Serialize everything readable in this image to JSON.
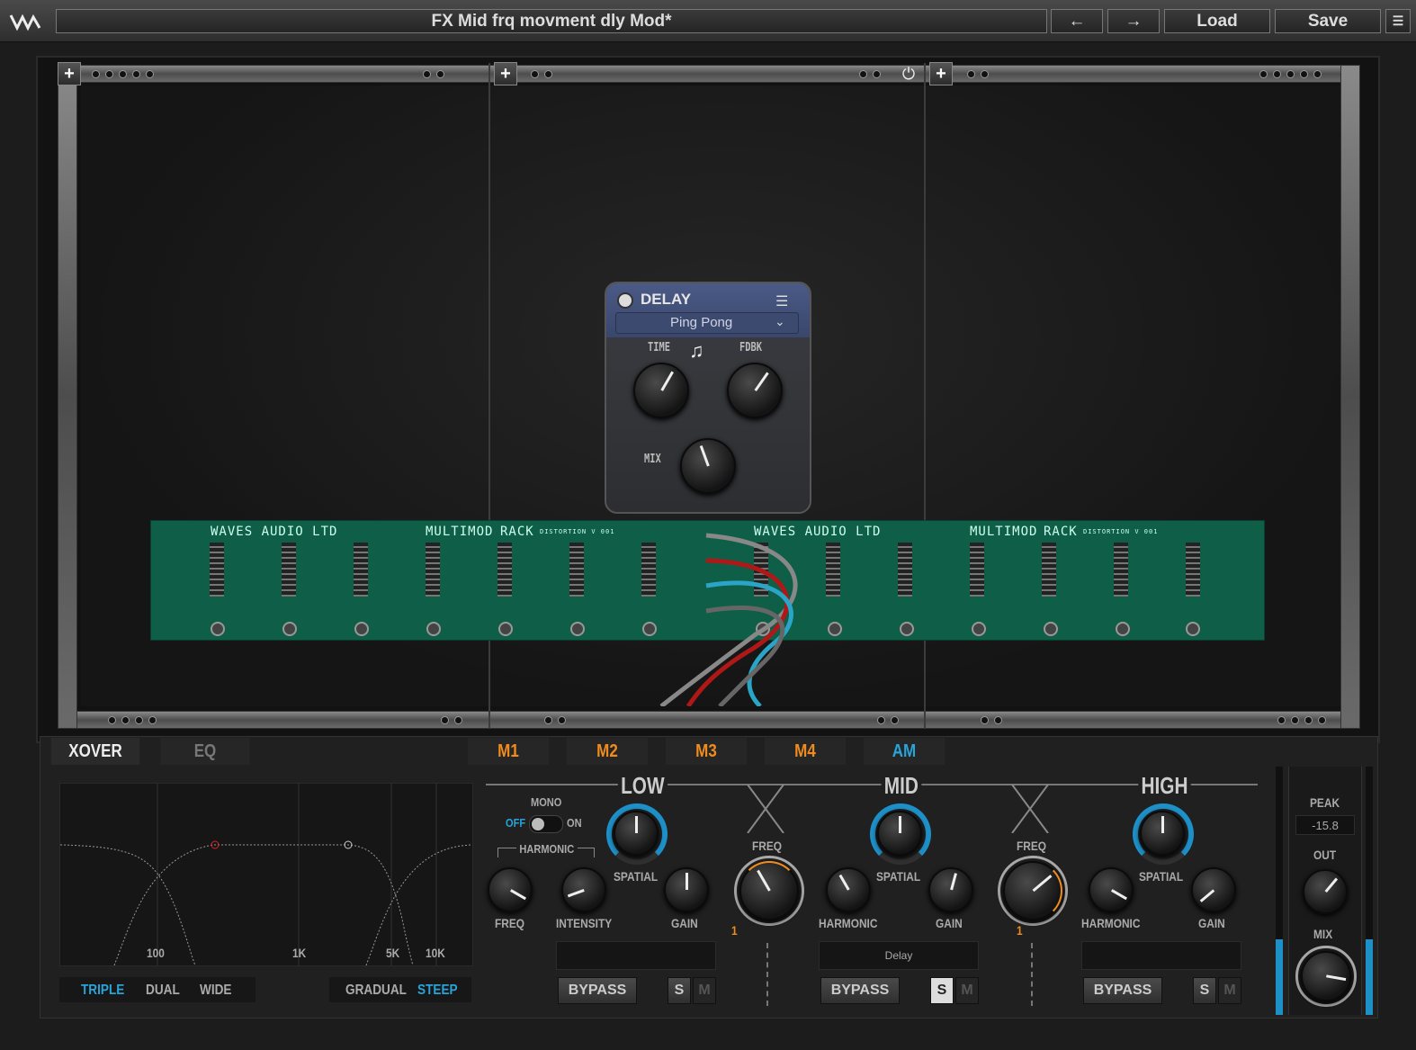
{
  "header": {
    "preset_title": "FX Mid frq movment dly Mod*",
    "load_label": "Load",
    "save_label": "Save",
    "undo_icon": "arrow-left-icon",
    "redo_icon": "arrow-right-icon",
    "logo_icon": "waves-logo-icon"
  },
  "rack": {
    "slot_add_label": "+",
    "power_icon": "power-icon"
  },
  "delay": {
    "title": "DELAY",
    "mode": "Ping Pong",
    "time_label": "TIME",
    "fdbk_label": "FDBK",
    "mix_label": "MIX",
    "note_icon": "music-note-icon",
    "menu_icon": "hamburger-menu-icon"
  },
  "pcb": {
    "maker": "WAVES AUDIO LTD",
    "maker2": "WAVES AUDIO LTD",
    "name": "MULTIMOD",
    "name2": "MULTIMOD",
    "rack": "RACK",
    "rack2": "RACK",
    "version": "DISTORTION V 001",
    "version2": "DISTORTION V 001"
  },
  "tabs": {
    "xover": "XOVER",
    "eq": "EQ",
    "m1": "M1",
    "m2": "M2",
    "m3": "M3",
    "m4": "M4",
    "am": "AM"
  },
  "xover": {
    "ticks": [
      "100",
      "1K",
      "5K",
      "10K"
    ],
    "mode": [
      "TRIPLE",
      "DUAL",
      "WIDE"
    ],
    "slope": [
      "GRADUAL",
      "STEEP"
    ],
    "accent": "#29a3d8"
  },
  "bands": {
    "mono_label": "MONO",
    "off": "OFF",
    "on": "ON",
    "harmonic_header": "HARMONIC",
    "freq": "FREQ",
    "intensity": "INTENSITY",
    "low": "LOW",
    "mid": "MID",
    "high": "HIGH",
    "spatial": "SPATIAL",
    "gain": "GAIN",
    "harmonic": "HARMONIC",
    "xfreq": "FREQ",
    "xfreq_val1": "1",
    "xfreq_val2": "1",
    "mid_display": "Delay",
    "bypass": "BYPASS",
    "solo": "S",
    "mute": "M"
  },
  "output": {
    "peak_label": "PEAK",
    "peak_value": "-15.8",
    "out_label": "OUT",
    "mix_label": "MIX"
  }
}
